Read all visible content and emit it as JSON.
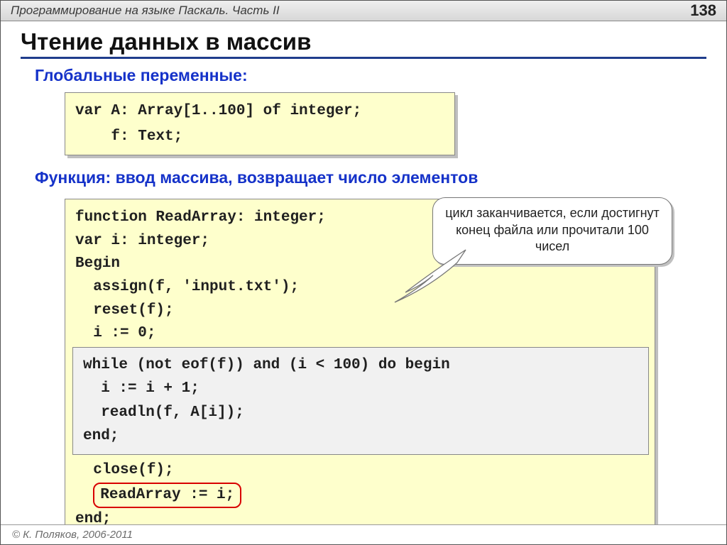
{
  "header": {
    "chapter": "Программирование на языке Паскаль. Часть II",
    "page": "138"
  },
  "title": "Чтение данных в массив",
  "sub1": "Глобальные переменные:",
  "code1": "var A: Array[1..100] of integer;\n    f: Text;",
  "sub2": "Функция: ввод массива, возвращает число элементов",
  "code2_top": "function ReadArray: integer;\nvar i: integer;\nBegin\n  assign(f, 'input.txt');\n  reset(f);\n  i := 0;",
  "code2_inset": "while (not eof(f)) and (i < 100) do begin\n  i := i + 1;\n  readln(f, A[i]);\nend;",
  "code2_close": "  close(f);",
  "code2_ring": "ReadArray := i;",
  "code2_end": "end;",
  "callout": "цикл заканчивается, если достигнут конец файла или прочитали 100 чисел",
  "footer": "© К. Поляков, 2006-2011"
}
